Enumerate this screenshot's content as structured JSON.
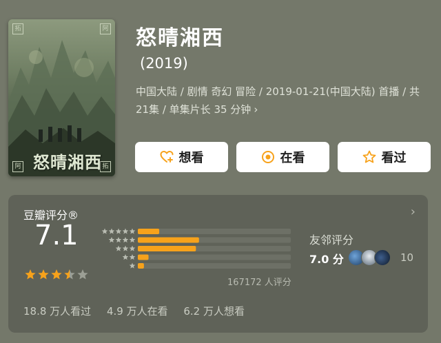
{
  "poster": {
    "title_text": "怒晴湘西",
    "corner_tl": "拓",
    "corner_tr": "阿",
    "corner_bl": "阿",
    "corner_br": "拓"
  },
  "title": "怒晴湘西",
  "year": "(2019)",
  "meta": "中国大陆 / 剧情 奇幻 冒险 / 2019-01-21(中国大陆) 首播 / 共 21集 / 单集片长 35 分钟",
  "actions": {
    "want": "想看",
    "watching": "在看",
    "watched": "看过"
  },
  "rating": {
    "title": "豆瓣评分®",
    "score": "7.1",
    "stars_value": 3.5,
    "max_stars": 5,
    "distribution": [
      {
        "stars": 5,
        "share": 0.14
      },
      {
        "stars": 4,
        "share": 0.4
      },
      {
        "stars": 3,
        "share": 0.38
      },
      {
        "stars": 2,
        "share": 0.07
      },
      {
        "stars": 1,
        "share": 0.04
      }
    ],
    "count_text": "167172 人评分",
    "friends_label": "友邻评分",
    "friends_score": "7.0 分",
    "friends_count": "10"
  },
  "stats": {
    "watched": "18.8 万人看过",
    "watching": "4.9 万人在看",
    "want": "6.2 万人想看"
  },
  "colors": {
    "background": "#74786a",
    "panel": "#5f6258",
    "accent_orange": "#f7a21b",
    "bar_track": "#6d7066",
    "star_empty": "#9c9f95"
  },
  "icons": [
    "heart-plus-icon",
    "target-icon",
    "star-outline-icon",
    "chevron-right-icon"
  ]
}
